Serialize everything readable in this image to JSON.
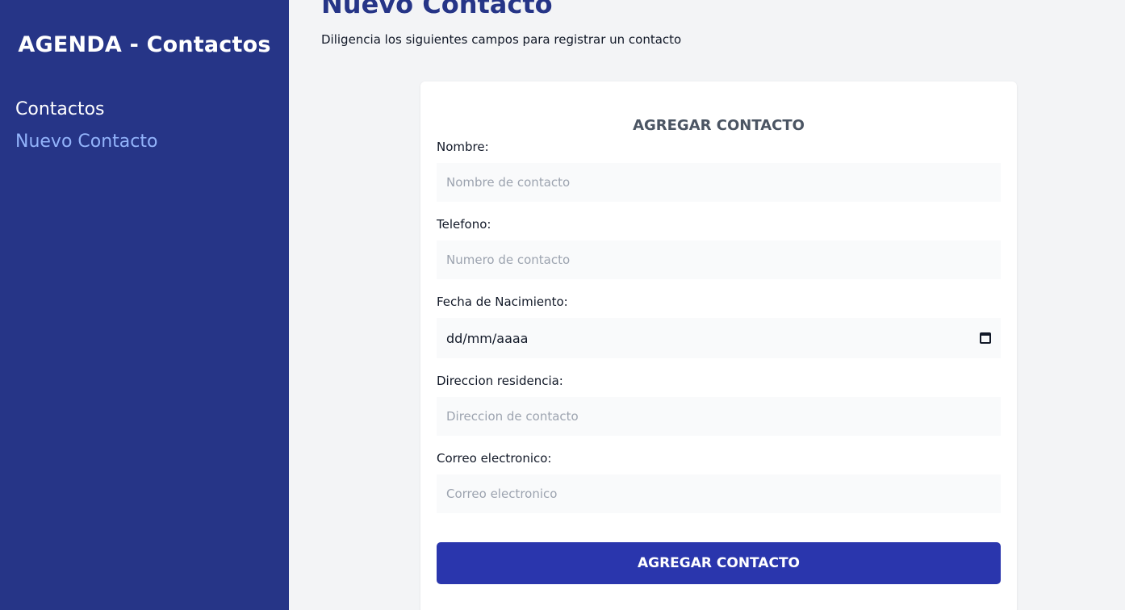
{
  "sidebar": {
    "brand": "AGENDA - Contactos",
    "items": [
      {
        "label": "Contactos",
        "active": false
      },
      {
        "label": "Nuevo Contacto",
        "active": true
      }
    ]
  },
  "header": {
    "title": "Nuevo Contacto",
    "subtitle": "Diligencia los siguientes campos para registrar un contacto"
  },
  "form": {
    "title": "AGREGAR CONTACTO",
    "nombre": {
      "label": "Nombre:",
      "placeholder": "Nombre de contacto",
      "value": ""
    },
    "telefono": {
      "label": "Telefono:",
      "placeholder": "Numero de contacto",
      "value": ""
    },
    "fecha": {
      "label": "Fecha de Nacimiento:",
      "display": "dd/mm/aaaa",
      "icon": "calendar-icon"
    },
    "direccion": {
      "label": "Direccion residencia:",
      "placeholder": "Direccion de contacto",
      "value": ""
    },
    "correo": {
      "label": "Correo electronico:",
      "placeholder": "Correo electronico",
      "value": ""
    },
    "submit_label": "AGREGAR CONTACTO"
  },
  "colors": {
    "sidebar_bg": "#263587",
    "active_link": "#93b4fb",
    "button_bg": "#2a36ad",
    "page_bg": "#f3f4f6"
  }
}
